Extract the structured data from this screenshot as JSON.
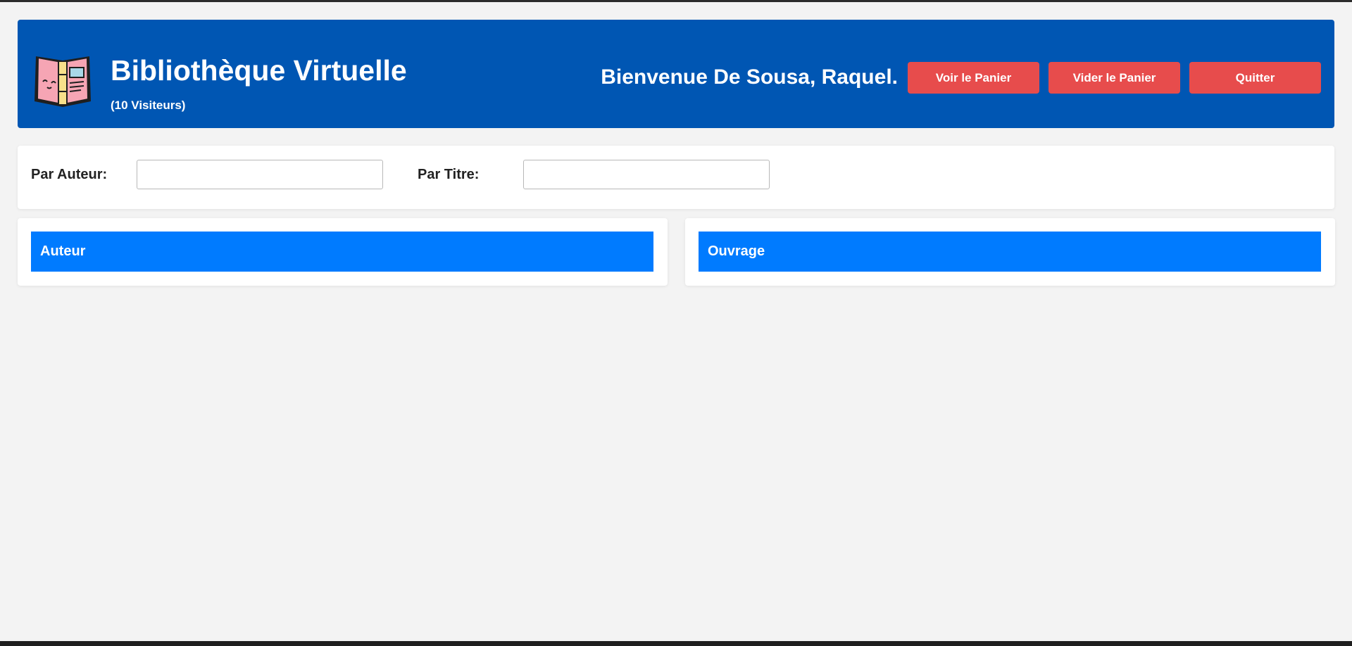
{
  "header": {
    "site_title": "Bibliothèque Virtuelle",
    "visitor_count": "(10 Visiteurs)",
    "welcome": "Bienvenue De Sousa, Raquel.",
    "logo_icon": "book-mascot-icon",
    "buttons": {
      "view_cart": "Voir le Panier",
      "clear_cart": "Vider le Panier",
      "quit": "Quitter"
    }
  },
  "search": {
    "author_label": "Par Auteur:",
    "author_value": "",
    "title_label": "Par Titre:",
    "title_value": ""
  },
  "panels": {
    "author_header": "Auteur",
    "work_header": "Ouvrage"
  },
  "colors": {
    "header_bg": "#0056b3",
    "button_bg": "#e74c4c",
    "panel_header_bg": "#007bff",
    "page_bg": "#f3f3f3"
  }
}
